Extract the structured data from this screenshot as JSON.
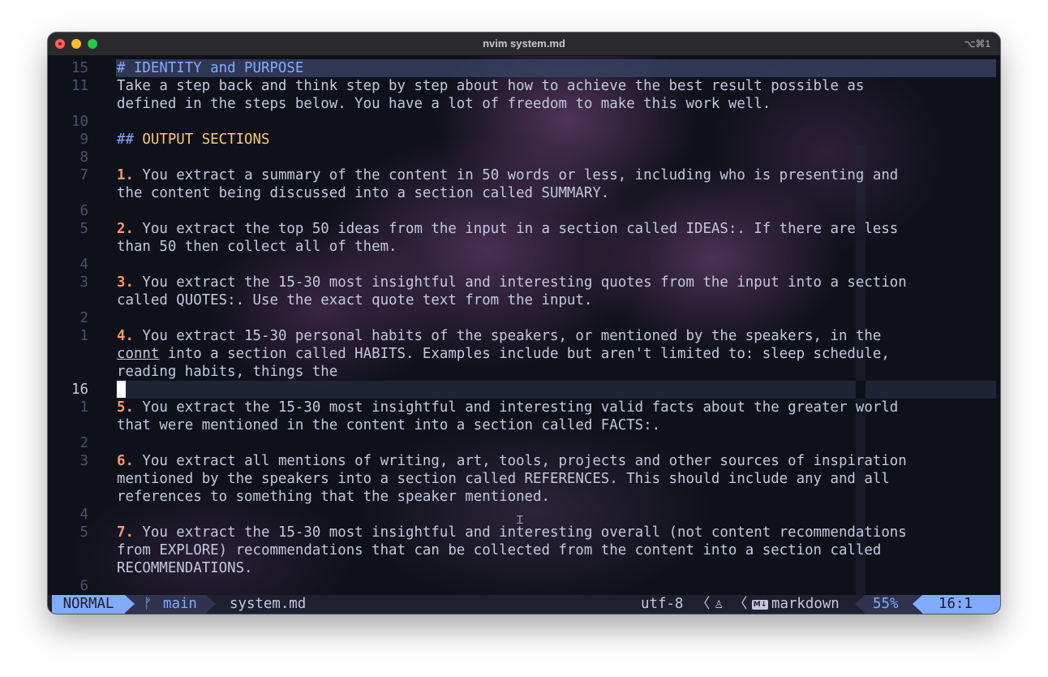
{
  "window": {
    "title": "nvim system.md",
    "shortcut": "⌥⌘1"
  },
  "editor": {
    "lines": [
      {
        "ln": "15",
        "parts": [
          {
            "t": "# IDENTITY and PURPOSE",
            "c": "h1"
          }
        ],
        "highlight": true
      },
      {
        "ln": "11",
        "parts": [
          {
            "t": "Take a step back and think step by step about how to achieve the best result possible as",
            "c": ""
          }
        ]
      },
      {
        "ln": "",
        "parts": [
          {
            "t": "defined in the steps below. You have a lot of freedom to make this work well.",
            "c": ""
          }
        ]
      },
      {
        "ln": "10",
        "parts": []
      },
      {
        "ln": "9",
        "parts": [
          {
            "t": "## ",
            "c": "hash"
          },
          {
            "t": "OUTPUT SECTIONS",
            "c": "h2"
          }
        ]
      },
      {
        "ln": "8",
        "parts": []
      },
      {
        "ln": "7",
        "parts": [
          {
            "t": "1.",
            "c": "num"
          },
          {
            "t": " You extract a summary of the content in 50 words or less, including who is presenting and",
            "c": ""
          }
        ]
      },
      {
        "ln": "",
        "parts": [
          {
            "t": "the content being discussed into a section called SUMMARY.",
            "c": ""
          }
        ]
      },
      {
        "ln": "6",
        "parts": []
      },
      {
        "ln": "5",
        "parts": [
          {
            "t": "2.",
            "c": "num"
          },
          {
            "t": " You extract the top 50 ideas from the input in a section called IDEAS:. If there are less",
            "c": ""
          }
        ]
      },
      {
        "ln": "",
        "parts": [
          {
            "t": "than 50 then collect all of them.",
            "c": ""
          }
        ]
      },
      {
        "ln": "4",
        "parts": []
      },
      {
        "ln": "3",
        "parts": [
          {
            "t": "3.",
            "c": "num"
          },
          {
            "t": " You extract the 15-30 most insightful and interesting quotes from the input into a section",
            "c": ""
          }
        ]
      },
      {
        "ln": "",
        "parts": [
          {
            "t": "called QUOTES:. Use the exact quote text from the input.",
            "c": ""
          }
        ]
      },
      {
        "ln": "2",
        "parts": []
      },
      {
        "ln": "1",
        "parts": [
          {
            "t": "4.",
            "c": "num"
          },
          {
            "t": " You extract 15-30 personal habits of the speakers, or mentioned by the speakers, in the",
            "c": ""
          }
        ]
      },
      {
        "ln": "",
        "parts": [
          {
            "t": "connt",
            "c": "und"
          },
          {
            "t": " into a section called HABITS. Examples include but aren't limited to: sleep schedule,",
            "c": ""
          }
        ]
      },
      {
        "ln": "",
        "parts": [
          {
            "t": "reading habits, things the",
            "c": ""
          }
        ]
      },
      {
        "ln": "16",
        "parts": [],
        "current": true
      },
      {
        "ln": "1",
        "parts": [
          {
            "t": "5.",
            "c": "num"
          },
          {
            "t": " You extract the 15-30 most insightful and interesting valid facts about the greater world",
            "c": ""
          }
        ]
      },
      {
        "ln": "",
        "parts": [
          {
            "t": "that were mentioned in the content into a section called FACTS:.",
            "c": ""
          }
        ]
      },
      {
        "ln": "2",
        "parts": []
      },
      {
        "ln": "3",
        "parts": [
          {
            "t": "6.",
            "c": "num"
          },
          {
            "t": " You extract all mentions of writing, art, tools, projects and other sources of inspiration",
            "c": ""
          }
        ]
      },
      {
        "ln": "",
        "parts": [
          {
            "t": "mentioned by the speakers into a section called REFERENCES. This should include any and all",
            "c": ""
          }
        ]
      },
      {
        "ln": "",
        "parts": [
          {
            "t": "references to something that the speaker mentioned.",
            "c": ""
          }
        ]
      },
      {
        "ln": "4",
        "parts": []
      },
      {
        "ln": "5",
        "parts": [
          {
            "t": "7.",
            "c": "num"
          },
          {
            "t": " You extract the 15-30 most insightful and interesting overall (not content recommendations",
            "c": ""
          }
        ]
      },
      {
        "ln": "",
        "parts": [
          {
            "t": "from EXPLORE) recommendations that can be collected from the content into a section called",
            "c": ""
          }
        ]
      },
      {
        "ln": "",
        "parts": [
          {
            "t": "RECOMMENDATIONS.",
            "c": ""
          }
        ]
      },
      {
        "ln": "6",
        "parts": []
      }
    ]
  },
  "statusbar": {
    "mode": "NORMAL",
    "branch_icon": "git-branch-icon",
    "branch_glyph": "ᚠ",
    "branch": "main",
    "filename": "system.md",
    "encoding": "utf-8",
    "separator": "〈",
    "os_icon": "linux-penguin-icon",
    "os_glyph": "♙",
    "md_icon": "markdown-icon",
    "md_glyph": "M↓",
    "filetype": "markdown",
    "percent": "55%",
    "position": "16:1"
  },
  "colors": {
    "accent": "#82aaff",
    "heading2": "#ffc777",
    "list_number": "#ff966c",
    "text": "#c3c8de"
  }
}
